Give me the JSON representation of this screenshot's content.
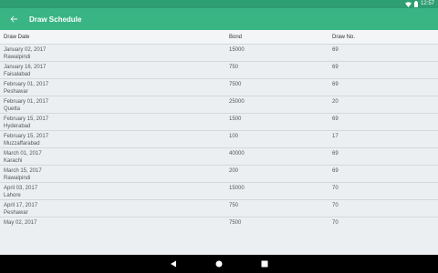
{
  "status_bar": {
    "time": "12:57"
  },
  "app_bar": {
    "title": "Draw Schedule"
  },
  "table": {
    "headers": {
      "date": "Draw Date",
      "bond": "Bond",
      "draw_no": "Draw No."
    },
    "rows": [
      {
        "date": "January 02, 2017",
        "city": "Rawalpindi",
        "bond": "15000",
        "draw_no": "69"
      },
      {
        "date": "January 16, 2017",
        "city": "Faisalabad",
        "bond": "750",
        "draw_no": "69"
      },
      {
        "date": "February 01, 2017",
        "city": "Peshawar",
        "bond": "7500",
        "draw_no": "69"
      },
      {
        "date": "February 01, 2017",
        "city": "Quetta",
        "bond": "25000",
        "draw_no": "20"
      },
      {
        "date": "February 15, 2017",
        "city": "Hyderabad",
        "bond": "1500",
        "draw_no": "69"
      },
      {
        "date": "February 15, 2017",
        "city": "Muzzaffarabad",
        "bond": "100",
        "draw_no": "17"
      },
      {
        "date": "March 01, 2017",
        "city": "Karachi",
        "bond": "40000",
        "draw_no": "69"
      },
      {
        "date": "March 15, 2017",
        "city": "Rawalpindi",
        "bond": "200",
        "draw_no": "69"
      },
      {
        "date": "April 03, 2017",
        "city": "Lahore",
        "bond": "15000",
        "draw_no": "70"
      },
      {
        "date": "April 17, 2017",
        "city": "Peshawar",
        "bond": "750",
        "draw_no": "70"
      },
      {
        "date": "May 02, 2017",
        "city": "",
        "bond": "7500",
        "draw_no": "70"
      }
    ]
  },
  "colors": {
    "status_bar": "#2e9e73",
    "app_bar": "#39b584",
    "background": "#eceff1"
  }
}
